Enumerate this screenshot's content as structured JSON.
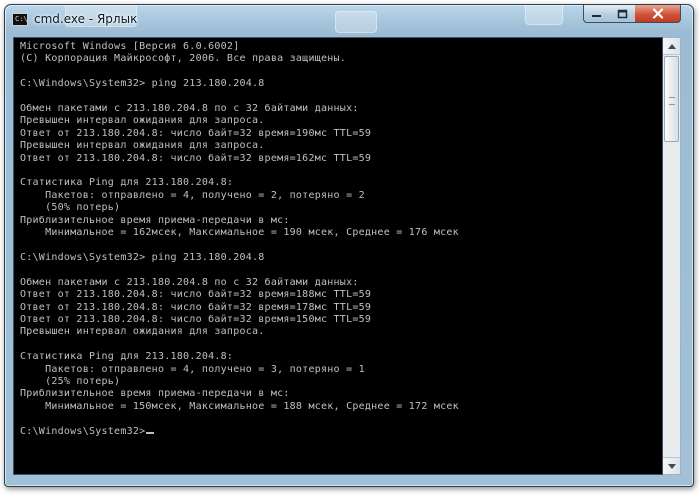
{
  "window": {
    "title": "cmd.exe - Ярлык",
    "app_icon_text": "C:\\"
  },
  "console": {
    "lines": [
      "Microsoft Windows [Версия 6.0.6002]",
      "(С) Корпорация Майкрософт, 2006. Все права защищены.",
      "",
      "C:\\Windows\\System32> ping 213.180.204.8",
      "",
      "Обмен пакетами с 213.180.204.8 по с 32 байтами данных:",
      "Превышен интервал ожидания для запроса.",
      "Ответ от 213.180.204.8: число байт=32 время=190мс TTL=59",
      "Превышен интервал ожидания для запроса.",
      "Ответ от 213.180.204.8: число байт=32 время=162мс TTL=59",
      "",
      "Статистика Ping для 213.180.204.8:",
      "    Пакетов: отправлено = 4, получено = 2, потеряно = 2",
      "    (50% потерь)",
      "Приблизительное время приема-передачи в мс:",
      "    Минимальное = 162мсек, Максимальное = 190 мсек, Среднее = 176 мсек",
      "",
      "C:\\Windows\\System32> ping 213.180.204.8",
      "",
      "Обмен пакетами с 213.180.204.8 по с 32 байтами данных:",
      "Ответ от 213.180.204.8: число байт=32 время=188мс TTL=59",
      "Ответ от 213.180.204.8: число байт=32 время=178мс TTL=59",
      "Ответ от 213.180.204.8: число байт=32 время=150мс TTL=59",
      "Превышен интервал ожидания для запроса.",
      "",
      "Статистика Ping для 213.180.204.8:",
      "    Пакетов: отправлено = 4, получено = 3, потеряно = 1",
      "    (25% потерь)",
      "Приблизительное время приема-передачи в мс:",
      "    Минимальное = 150мсек, Максимальное = 188 мсек, Среднее = 172 мсек",
      ""
    ],
    "prompt": "C:\\Windows\\System32>"
  },
  "colors": {
    "console_bg": "#000000",
    "console_text": "#c0c0c0",
    "close_button": "#c8452a"
  },
  "icons": {
    "app": "cmd-icon",
    "minimize": "minimize-icon",
    "maximize": "maximize-icon",
    "close": "close-icon",
    "scroll_up": "arrow-up-icon",
    "scroll_down": "arrow-down-icon"
  }
}
